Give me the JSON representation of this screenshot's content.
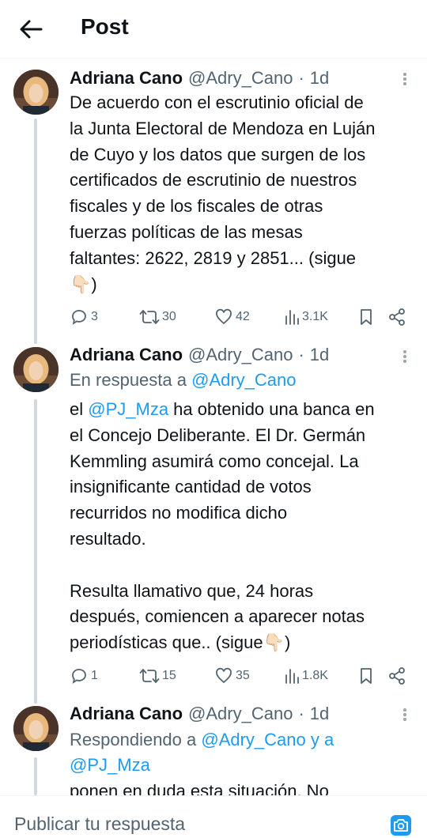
{
  "header": {
    "title": "Post"
  },
  "tweets": [
    {
      "name": "Adriana Cano",
      "handle": "@Adry_Cano",
      "dot": "·",
      "time": "1d",
      "lines": [
        "De acuerdo con el escrutinio oficial de",
        "la Junta Electoral de Mendoza en Luján",
        "de Cuyo y los datos que surgen de los",
        "certificados de escrutinio de nuestros",
        "fiscales y de los fiscales de otras",
        "fuerzas políticas de las mesas",
        "faltantes: 2622, 2819 y 2851... (sigue",
        "👇🏻)"
      ],
      "replies": "3",
      "reposts": "30",
      "likes": "42",
      "views": "3.1K"
    },
    {
      "name": "Adriana Cano",
      "handle": "@Adry_Cano",
      "dot": "·",
      "time": "1d",
      "reply_prefix": "En respuesta a ",
      "reply_to": "@Adry_Cano",
      "mention": "@PJ_Mza",
      "lines_first_prefix": "el ",
      "lines_first_suffix": " ha obtenido una banca en",
      "lines": [
        "el Concejo Deliberante. El Dr. Germán",
        "Kemmling asumirá como concejal. La",
        "insignificante cantidad de votos",
        "recurridos no modifica dicho",
        "resultado.",
        "",
        "Resulta llamativo que, 24 horas",
        "después, comiencen a aparecer notas",
        "periodísticas que.. (sigue👇🏻)"
      ],
      "replies": "1",
      "reposts": "15",
      "likes": "35",
      "views": "1.8K"
    },
    {
      "name": "Adriana Cano",
      "handle": "@Adry_Cano",
      "dot": "·",
      "time": "1d",
      "reply_prefix": "Respondiendo a ",
      "reply_to": "@Adry_Cano y a",
      "reply_to_2": "@PJ_Mza",
      "cut_line": "ponen en duda esta situación. No"
    }
  ],
  "compose": {
    "placeholder": "Publicar tu respuesta"
  },
  "icons": {
    "back": "arrow-left-icon",
    "more": "more-vertical-icon",
    "reply": "reply-icon",
    "repost": "repost-icon",
    "like": "heart-icon",
    "views": "views-icon",
    "bookmark": "bookmark-icon",
    "share": "share-icon",
    "camera": "camera-icon"
  },
  "colors": {
    "link": "#1d9bf0",
    "muted": "#536471",
    "text": "#0f1419",
    "thread": "#cfd9de"
  }
}
